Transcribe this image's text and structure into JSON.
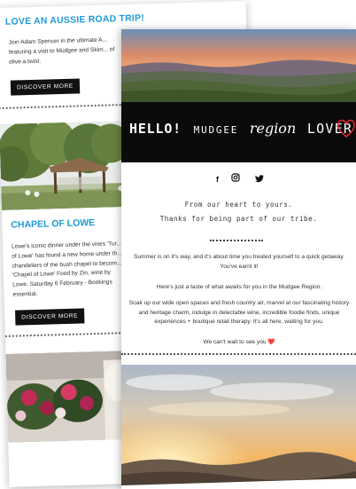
{
  "back_card": {
    "title": "LOVE AN AUSSIE ROAD TRIP!",
    "intro": "Join Adam Spencer in the ultimate A... featuring a visit to Mudgee and Skim... of olive.a.twist.",
    "discover_label_1": "DISCOVER MORE",
    "section_title": "CHAPEL OF LOWE",
    "section_text": "Lowe's iconic dinner under the vines 'Tur... of Lowe' has found a new home under th... chandeliers of the bush chapel to becom... 'Chapel of Lowe' Food by Zin, wine by Lowe. Saturday 6 February - Bookings essential.",
    "discover_label_2": "DISCOVER MORE"
  },
  "front_card": {
    "banner": {
      "hello": "HELLO!",
      "mudgee": "MUDGEE",
      "region": "region",
      "lover": "LOVER"
    },
    "social": {
      "facebook": "f",
      "instagram": "◎",
      "twitter": "🐦"
    },
    "tagline_1": "From our heart to yours.",
    "tagline_2": "Thanks for being part of our tribe.",
    "para_1": "Summer is on it's way, and it's about time you treated yourself to a quick getaway. You've earnt it!",
    "para_2": "Here's just a taste of what awaits for you in the Mudgee Region.",
    "para_3": "Soak up our wide open spaces and fresh country air, marvel at our fascinating history and heritage charm, indulge in delectable wine, incredible foodie finds, unique experiences + boutique retail therapy. It's all here, waiting for you.",
    "para_4": "We can't wait to see you ❤️"
  },
  "colors": {
    "accent_blue": "#1f9ad6",
    "heart_red": "#e0282b",
    "banner_black": "#0b0b0b"
  },
  "icons": [
    "facebook-icon",
    "instagram-icon",
    "twitter-icon",
    "heart-outline-icon",
    "heart-icon"
  ]
}
